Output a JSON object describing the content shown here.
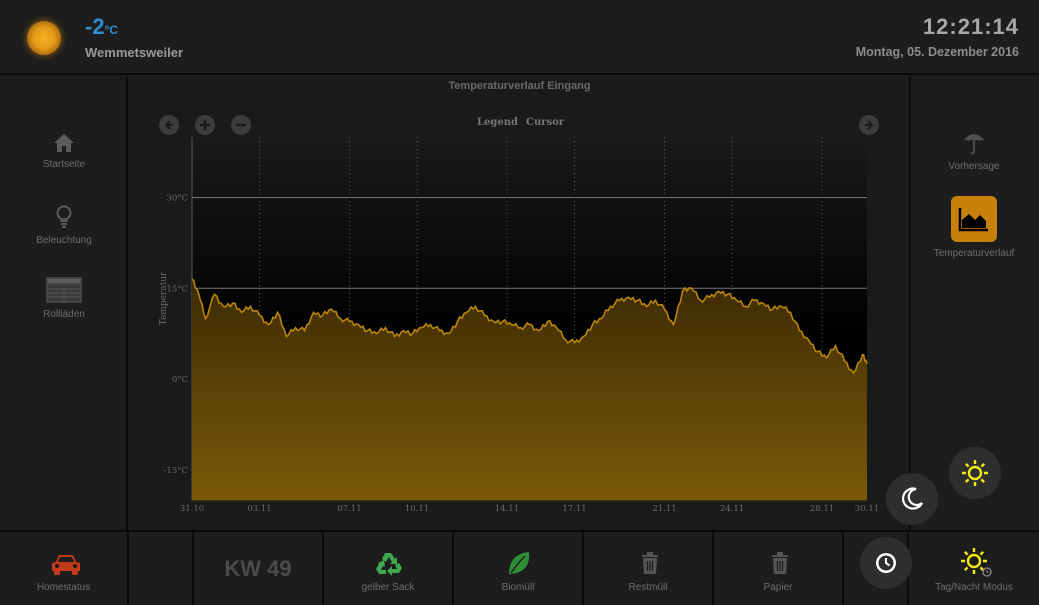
{
  "header": {
    "temperature": "-2",
    "temperature_unit": "°C",
    "location": "Wemmetsweiler",
    "time": "12:21:14",
    "date": "Montag, 05. Dezember 2016"
  },
  "sidebar_left": [
    {
      "label": "Startseite",
      "icon": "home-icon"
    },
    {
      "label": "Beleuchtung",
      "icon": "lightbulb-icon"
    },
    {
      "label": "Rollläden",
      "icon": "shutter-icon"
    }
  ],
  "sidebar_right": [
    {
      "label": "Vorhersage",
      "icon": "umbrella-icon"
    },
    {
      "label": "Temperaturverlauf",
      "icon": "area-chart-icon",
      "active": true
    }
  ],
  "chart_controls": {
    "legend_label": "Legend",
    "cursor_label": "Cursor"
  },
  "chart_data": {
    "type": "area",
    "title": "Temperaturverlauf Eingang",
    "ylabel": "Temperatur",
    "xlabel": "",
    "ylim": [
      -20,
      40
    ],
    "y_ticks": [
      -15,
      0,
      15,
      30
    ],
    "y_tick_labels": [
      "-15°C",
      "0°C",
      "15°C",
      "30°C"
    ],
    "x_ticks": [
      "31.10",
      "03.11",
      "07.11",
      "10.11",
      "14.11",
      "17.11",
      "21.11",
      "24.11",
      "28.11",
      "30.11"
    ],
    "x_tick_days": [
      0,
      3,
      7,
      10,
      14,
      17,
      21,
      24,
      28,
      30
    ],
    "x_tick_dates": [
      "2016-10-31",
      "2016-11-03",
      "2016-11-07",
      "2016-11-10",
      "2016-11-14",
      "2016-11-17",
      "2016-11-21",
      "2016-11-24",
      "2016-11-28",
      "2016-11-30"
    ],
    "grid": true,
    "series": [
      {
        "name": "",
        "color": "#b8860b",
        "x_dates": [
          "2016-10-31",
          "2016-11-01",
          "2016-11-02",
          "2016-11-03",
          "2016-11-04",
          "2016-11-05",
          "2016-11-06",
          "2016-11-07",
          "2016-11-08",
          "2016-11-09",
          "2016-11-10",
          "2016-11-11",
          "2016-11-12",
          "2016-11-13",
          "2016-11-14",
          "2016-11-15",
          "2016-11-16",
          "2016-11-17",
          "2016-11-18",
          "2016-11-19",
          "2016-11-20",
          "2016-11-21",
          "2016-11-22",
          "2016-11-23",
          "2016-11-24",
          "2016-11-25",
          "2016-11-26",
          "2016-11-27",
          "2016-11-28",
          "2016-11-29",
          "2016-11-30"
        ],
        "x": [
          0,
          0.3,
          0.6,
          1.0,
          1.4,
          1.8,
          2.2,
          2.6,
          3.0,
          3.4,
          3.8,
          4.2,
          4.6,
          5.0,
          5.4,
          5.8,
          6.2,
          6.6,
          7.0,
          7.4,
          7.8,
          8.2,
          8.6,
          9.0,
          9.4,
          9.8,
          10.2,
          10.6,
          11.0,
          11.4,
          11.8,
          12.2,
          12.6,
          13.0,
          13.4,
          13.8,
          14.2,
          14.6,
          15.0,
          15.4,
          15.8,
          16.2,
          16.6,
          17.0,
          17.4,
          17.8,
          18.2,
          18.6,
          19.0,
          19.4,
          19.8,
          20.2,
          20.6,
          21.0,
          21.4,
          21.8,
          22.2,
          22.6,
          23.0,
          23.4,
          23.8,
          24.2,
          24.6,
          25.0,
          25.4,
          25.8,
          26.2,
          26.6,
          27.0,
          27.4,
          27.8,
          28.2,
          28.6,
          29.0,
          29.4,
          29.8,
          30.0
        ],
        "values": [
          16.5,
          14.0,
          10.0,
          14.0,
          12.0,
          12.5,
          11.0,
          12.0,
          10.5,
          9.0,
          11.0,
          7.0,
          8.5,
          8.0,
          11.0,
          10.5,
          11.5,
          10.0,
          9.5,
          9.0,
          8.0,
          7.5,
          8.5,
          7.0,
          8.0,
          7.5,
          8.5,
          9.0,
          8.0,
          7.5,
          9.5,
          11.0,
          12.0,
          10.5,
          9.5,
          9.5,
          9.0,
          8.5,
          9.0,
          8.0,
          9.5,
          8.5,
          6.5,
          6.0,
          7.0,
          9.0,
          10.0,
          12.0,
          13.0,
          13.5,
          13.0,
          12.0,
          13.0,
          11.5,
          9.0,
          14.5,
          15.0,
          13.0,
          13.5,
          14.5,
          14.0,
          13.0,
          12.0,
          13.0,
          12.5,
          11.5,
          12.0,
          11.0,
          8.0,
          6.5,
          4.5,
          3.5,
          5.5,
          3.0,
          1.0,
          4.0,
          2.5
        ]
      }
    ]
  },
  "bottom_bar": {
    "homestatus": "Homestatus",
    "kw": "KW 49",
    "gelber_sack": "gelber Sack",
    "biomuell": "Biomüll",
    "restmuell": "Restmüll",
    "papier": "Papier",
    "tag_nacht": "Tag/Nacht Modus"
  },
  "colors": {
    "accent_orange": "#c7800b",
    "temp_blue": "#2d8fcf",
    "recycling_green": "#3fa84f",
    "biomuell_green": "#2f8f37",
    "car_red": "#c23a1a",
    "sun_yellow": "#f2e812"
  }
}
